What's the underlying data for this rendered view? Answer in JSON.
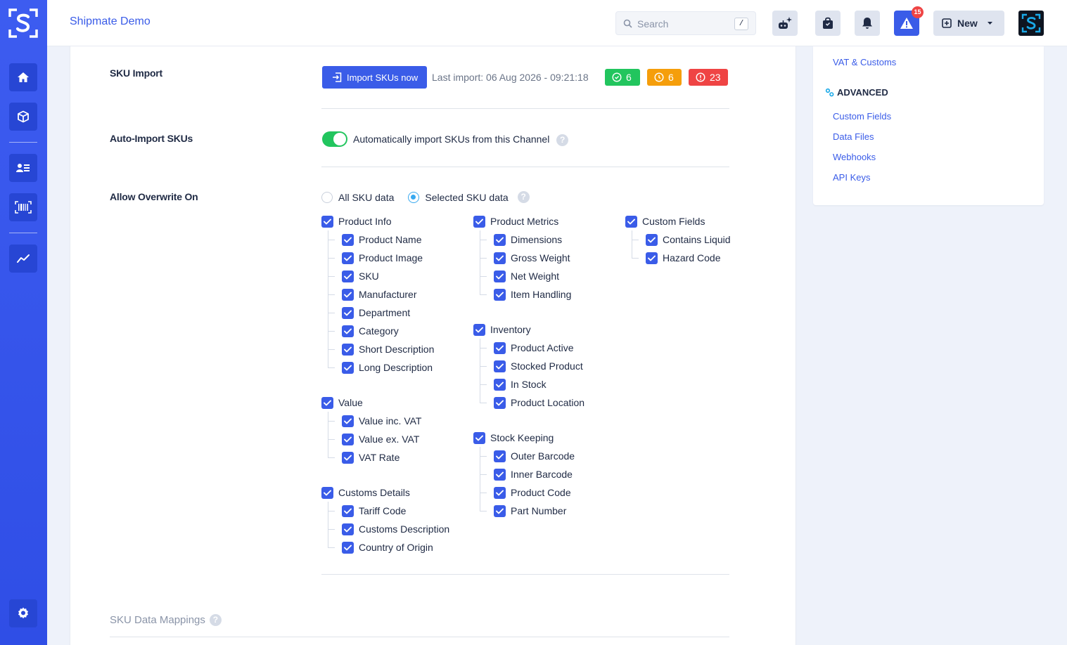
{
  "app": {
    "title": "Shipmate Demo"
  },
  "search": {
    "placeholder": "Search",
    "shortcut": "/"
  },
  "topbar": {
    "alert_count": "15",
    "new_label": "New"
  },
  "colors": {
    "accent": "#3a5ce8",
    "success": "#22c55e",
    "warning": "#f59e0b",
    "danger": "#ef4444"
  },
  "sku_import": {
    "label": "SKU Import",
    "button_label": "Import SKUs now",
    "last_import": "Last import: 06 Aug 2026 - 09:21:18",
    "success_count": "6",
    "warning_count": "6",
    "error_count": "23"
  },
  "auto_import": {
    "label": "Auto-Import SKUs",
    "enabled": true,
    "text": "Automatically import SKUs from this Channel"
  },
  "overwrite": {
    "label": "Allow Overwrite On",
    "option_all": "All SKU data",
    "option_selected": "Selected SKU data",
    "selected": "Selected SKU data",
    "product_info": {
      "label": "Product Info",
      "items": [
        "Product Name",
        "Product Image",
        "SKU",
        "Manufacturer",
        "Department",
        "Category",
        "Short Description",
        "Long Description"
      ]
    },
    "value": {
      "label": "Value",
      "items": [
        "Value inc. VAT",
        "Value ex. VAT",
        "VAT Rate"
      ]
    },
    "customs": {
      "label": "Customs Details",
      "items": [
        "Tariff Code",
        "Customs Description",
        "Country of Origin"
      ]
    },
    "metrics": {
      "label": "Product Metrics",
      "items": [
        "Dimensions",
        "Gross Weight",
        "Net Weight",
        "Item Handling"
      ]
    },
    "inventory": {
      "label": "Inventory",
      "items": [
        "Product Active",
        "Stocked Product",
        "In Stock",
        "Product Location"
      ]
    },
    "stock_keeping": {
      "label": "Stock Keeping",
      "items": [
        "Outer Barcode",
        "Inner Barcode",
        "Product Code",
        "Part Number"
      ]
    },
    "custom_fields": {
      "label": "Custom Fields",
      "items": [
        "Contains Liquid",
        "Hazard Code"
      ]
    }
  },
  "sku_data_mappings": {
    "label": "SKU Data Mappings"
  },
  "help_glyph": "?",
  "right_panel": {
    "link_vat": "VAT & Customs",
    "section_advanced": "ADVANCED",
    "links": [
      "Custom Fields",
      "Data Files",
      "Webhooks",
      "API Keys"
    ]
  }
}
